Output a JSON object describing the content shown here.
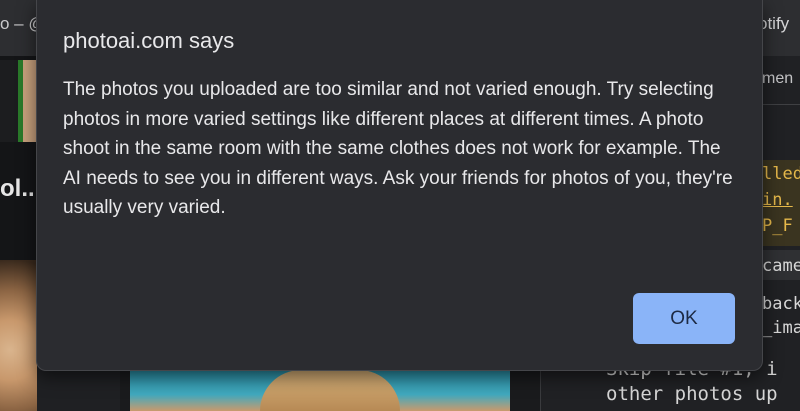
{
  "background": {
    "tab_title": "o – @",
    "tab_right": "otify",
    "left_text": "ol...",
    "right_tab": "men",
    "right_pipe": "|",
    "code_lines": [
      "lled",
      "in.",
      "P_F",
      "came",
      "back",
      "_ima"
    ],
    "console_lines": [
      "Skip file #1, i",
      "other photos up"
    ]
  },
  "dialog": {
    "title": "photoai.com says",
    "message": "The photos you uploaded are too similar and not varied enough. Try selecting photos in more varied settings like different places at different times. A photo shoot in the same room with the same clothes does not work for example. The AI needs to see you in different ways. Ask your friends for photos of you, they're usually very varied.",
    "ok_label": "OK",
    "accent_color": "#8ab4f8"
  }
}
